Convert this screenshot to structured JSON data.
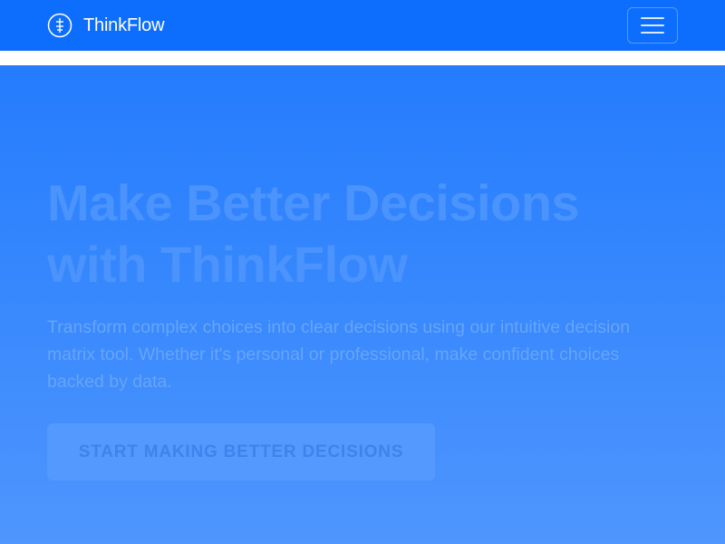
{
  "navbar": {
    "brand_name": "ThinkFlow",
    "brand_icon": "compass-icon",
    "menu_icon": "hamburger-menu-icon",
    "background_color": "#0d6efd"
  },
  "hero": {
    "title": "Make Better Decisions with ThinkFlow",
    "subtitle": "Transform complex choices into clear decisions using our intuitive decision matrix tool. Whether it's personal or professional, make confident choices backed by data.",
    "cta_label": "START MAKING BETTER DECISIONS",
    "background_top_color": "#247cfd",
    "background_bottom_color": "#4f96fe"
  }
}
